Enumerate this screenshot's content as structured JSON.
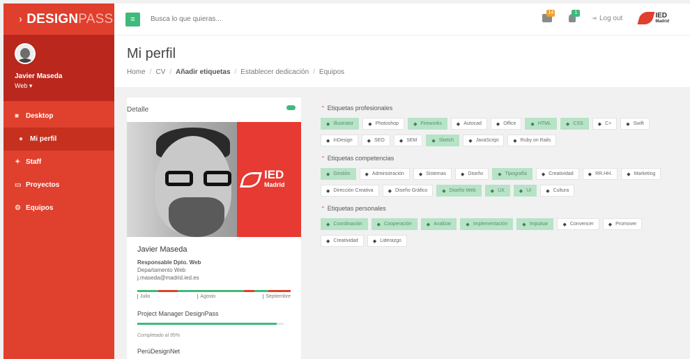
{
  "brand": {
    "main": "DESIGN",
    "suffix": "PASS"
  },
  "user": {
    "name": "Javier Maseda",
    "role": "Web ▾"
  },
  "nav": [
    {
      "icon": "■",
      "label": "Desktop",
      "active": false
    },
    {
      "icon": "●",
      "label": "Mi perfil",
      "active": true
    },
    {
      "icon": "✦",
      "label": "Staff",
      "active": false
    },
    {
      "icon": "▭",
      "label": "Proyectos",
      "active": false
    },
    {
      "icon": "⚙",
      "label": "Equipos",
      "active": false
    }
  ],
  "topbar": {
    "search_placeholder": "Busca lo que quieras...",
    "notif1_count": "14",
    "notif2_count": "1",
    "logout": "Log out",
    "logo_text": "IED",
    "logo_sub": "Madrid"
  },
  "page": {
    "title": "Mi perfil",
    "breadcrumb": [
      "Home",
      "CV",
      "Añadir etiquetas",
      "Establecer dedicación",
      "Equipos"
    ]
  },
  "card": {
    "title": "Detalle",
    "photo_logo": "IED",
    "photo_logo_sub": "Madrid",
    "name": "Javier Maseda",
    "role": "Responsable Dpto. Web",
    "department": "Departamento Web",
    "email": "j.maseda@madrid.ied.es",
    "timeline_months": [
      "Julio",
      "Agosto",
      "Septiembre"
    ],
    "project1": "Project Manager DesignPass",
    "progress": 0.95,
    "completed": "Completado al 95%",
    "project2": "PerúDesignNet"
  },
  "sections": [
    {
      "title": "Etiquetas profesionales",
      "tags": [
        {
          "label": "Illustrator",
          "on": true
        },
        {
          "label": "Photoshop",
          "on": false
        },
        {
          "label": "Fireworks",
          "on": true
        },
        {
          "label": "Autocad",
          "on": false
        },
        {
          "label": "Office",
          "on": false
        },
        {
          "label": "HTML",
          "on": true
        },
        {
          "label": "CSS",
          "on": true
        },
        {
          "label": "C+",
          "on": false
        },
        {
          "label": "Swift",
          "on": false
        },
        {
          "label": "inDesign",
          "on": false
        },
        {
          "label": "SEO",
          "on": false
        },
        {
          "label": "SEM",
          "on": false
        },
        {
          "label": "Sketch",
          "on": true
        },
        {
          "label": "JavaScript",
          "on": false
        },
        {
          "label": "Ruby on Rails",
          "on": false
        }
      ]
    },
    {
      "title": "Etiquetas competencias",
      "tags": [
        {
          "label": "Gestión",
          "on": true
        },
        {
          "label": "Administración",
          "on": false
        },
        {
          "label": "Sistemas",
          "on": false
        },
        {
          "label": "Diseño",
          "on": false
        },
        {
          "label": "Tipografía",
          "on": true
        },
        {
          "label": "Creatividad",
          "on": false
        },
        {
          "label": "RR.HH.",
          "on": false
        },
        {
          "label": "Marketing",
          "on": false
        },
        {
          "label": "Dirección Creativa",
          "on": false
        },
        {
          "label": "Diseño Gráfico",
          "on": false
        },
        {
          "label": "Diseño Web",
          "on": true
        },
        {
          "label": "UX",
          "on": true
        },
        {
          "label": "UI",
          "on": true
        },
        {
          "label": "Cultura",
          "on": false
        }
      ]
    },
    {
      "title": "Etiquetas personales",
      "tags": [
        {
          "label": "Coordinación",
          "on": true
        },
        {
          "label": "Cooperación",
          "on": true
        },
        {
          "label": "Analizar",
          "on": true
        },
        {
          "label": "Implementación",
          "on": true
        },
        {
          "label": "Impulsar",
          "on": true
        },
        {
          "label": "Convencer",
          "on": false
        },
        {
          "label": "Promover",
          "on": false
        },
        {
          "label": "Creatividad",
          "on": false
        },
        {
          "label": "Liderazgo",
          "on": false
        }
      ]
    }
  ],
  "colors": {
    "brand_red": "#e0402e",
    "accent_green": "#3fba7a",
    "tag_on": "#b7e3c7"
  }
}
